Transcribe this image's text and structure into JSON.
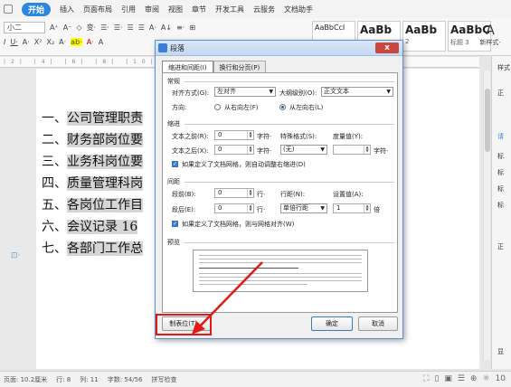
{
  "menubar": {
    "start_label": "开始",
    "items": [
      "插入",
      "页面布局",
      "引用",
      "审阅",
      "视图",
      "章节",
      "开发工具",
      "云服务",
      "文档助手"
    ]
  },
  "ribbon": {
    "font_size": "小二",
    "row1_tools": [
      "A⁺",
      "A⁻",
      "◇",
      "变·",
      "☰·",
      "☰·",
      "☰",
      "☰",
      "A·",
      "A↓",
      "≡·",
      "⊞"
    ],
    "row2_tools": [
      "I",
      "U·",
      "A·",
      "X²",
      "X₂",
      "A·",
      "ab·",
      "A·",
      "A"
    ],
    "styles": [
      {
        "sample": "AaBbCcI",
        "label": "",
        "kind": "normal"
      },
      {
        "sample": "AaBb",
        "label": "",
        "kind": "big"
      },
      {
        "sample": "AaBb",
        "label": "2",
        "kind": "big"
      },
      {
        "sample": "AaBbC(",
        "label": "标题 3",
        "kind": "big"
      }
    ],
    "new_style": "新样式·"
  },
  "ruler_text": "|2| |4| |6| |8| |10|",
  "document": {
    "lines": [
      {
        "num": "一、",
        "text": "公司管理职责"
      },
      {
        "num": "二、",
        "text": "财务部岗位要"
      },
      {
        "num": "三、",
        "text": "业务科岗位要"
      },
      {
        "num": "四、",
        "text": "质量管理科岗"
      },
      {
        "num": "五、",
        "text": "各岗位工作目"
      },
      {
        "num": "六、",
        "text": "会议记录 16"
      },
      {
        "num": "七、",
        "text": "各部门工作总"
      }
    ]
  },
  "right_panel": [
    "样式",
    "正",
    "请",
    "标",
    "标",
    "标",
    "标",
    "显",
    "正"
  ],
  "dialog": {
    "title": "段落",
    "close": "x",
    "tabs": [
      "缩进和间距(I)",
      "换行和分页(P)"
    ],
    "general": {
      "section": "常规",
      "alignment_label": "对齐方式(G):",
      "alignment_value": "左对齐",
      "outline_label": "大纲级别(O):",
      "outline_value": "正文文本",
      "direction_label": "方向:",
      "rtl_label": "从右向左(F)",
      "ltr_label": "从左向右(L)",
      "ltr_selected": true
    },
    "indent": {
      "section": "缩进",
      "before_label": "文本之前(R):",
      "before_value": "0",
      "before_unit": "字符·",
      "special_label": "特殊格式(S):",
      "special_value": "(无)",
      "measure_label": "度量值(Y):",
      "measure_value": "",
      "measure_unit": "字符·",
      "after_label": "文本之后(X):",
      "after_value": "0",
      "after_unit": "字符·",
      "grid_check_label": "如果定义了文档网格，则自动调整右缩进(D)"
    },
    "spacing": {
      "section": "间距",
      "before_label": "段前(B):",
      "before_value": "0",
      "before_unit": "行·",
      "line_label": "行距(N):",
      "line_value": "单倍行距",
      "setting_label": "设置值(A):",
      "setting_value": "1",
      "setting_unit": "倍",
      "after_label": "段后(E):",
      "after_value": "0",
      "after_unit": "行·",
      "grid_check_label": "如果定义了文档网格，则与网格对齐(W)"
    },
    "preview_label": "预览",
    "tab_button": "制表位(T)...",
    "ok_button": "确定",
    "cancel_button": "取消"
  },
  "statusbar": {
    "position": "页面: 10.2厘米",
    "row": "行: 8",
    "col": "列: 11",
    "words": "字数: 54/56",
    "spellcheck": "拼写检查",
    "zoom": "10"
  },
  "colors": {
    "accent": "#2e86de",
    "highlight": "#e01919"
  }
}
